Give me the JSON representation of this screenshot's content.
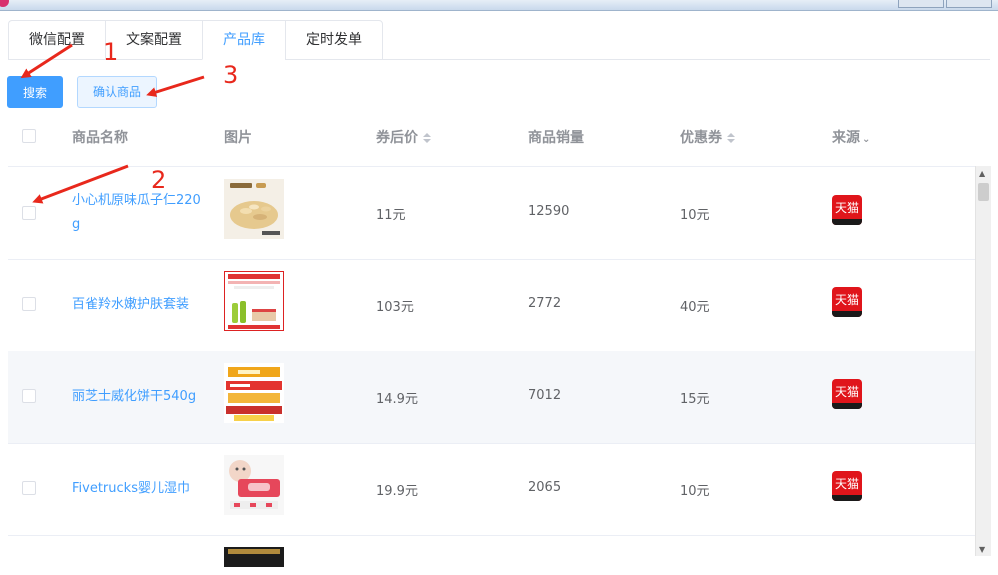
{
  "tabs": [
    {
      "label": "微信配置"
    },
    {
      "label": "文案配置"
    },
    {
      "label": "产品库"
    },
    {
      "label": "定时发单"
    }
  ],
  "active_tab": "产品库",
  "toolbar": {
    "search_label": "搜索",
    "confirm_label": "确认商品"
  },
  "annotations": [
    "1",
    "2",
    "3"
  ],
  "table": {
    "headers": {
      "name": "商品名称",
      "image": "图片",
      "price": "券后价",
      "sales": "商品销量",
      "coupon": "优惠券",
      "source": "来源"
    },
    "rows": [
      {
        "name": "小心机原味瓜子仁220g",
        "price": "11元",
        "sales": "12590",
        "coupon": "10元",
        "source": "天猫"
      },
      {
        "name": "百雀羚水嫩护肤套装",
        "price": "103元",
        "sales": "2772",
        "coupon": "40元",
        "source": "天猫"
      },
      {
        "name": "丽芝士威化饼干540g",
        "price": "14.9元",
        "sales": "7012",
        "coupon": "15元",
        "source": "天猫"
      },
      {
        "name": "Fivetrucks婴儿湿巾",
        "price": "19.9元",
        "sales": "2065",
        "coupon": "10元",
        "source": "天猫"
      }
    ]
  },
  "colors": {
    "primary": "#409eff",
    "annotation": "#e8281c",
    "tmall": "#e0151b"
  }
}
